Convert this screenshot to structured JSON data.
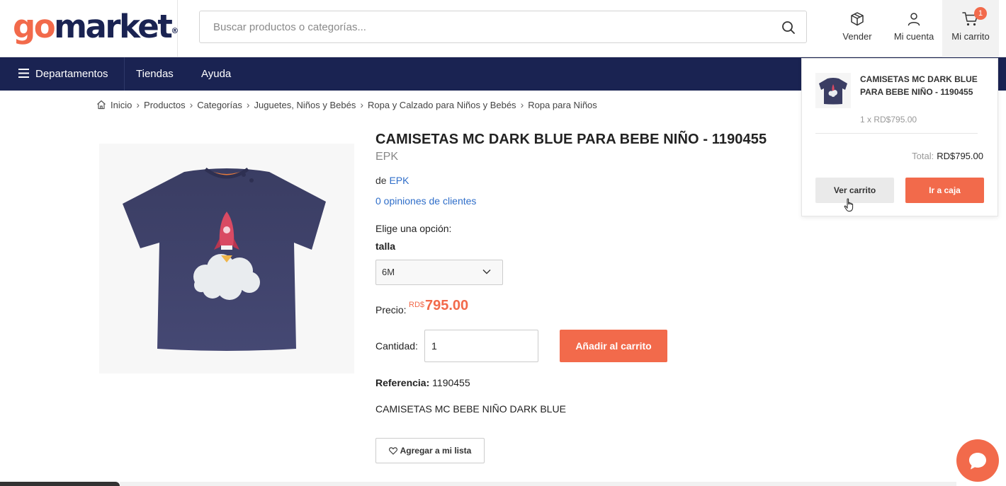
{
  "brand": {
    "logo_go": "go",
    "logo_market": "market",
    "logo_reg": "®"
  },
  "search": {
    "placeholder": "Buscar productos o categorías..."
  },
  "header_actions": {
    "sell": "Vender",
    "account": "Mi cuenta",
    "cart": "Mi carrito",
    "cart_count": "1"
  },
  "nav": {
    "departments": "Departamentos",
    "stores": "Tiendas",
    "help": "Ayuda"
  },
  "breadcrumb": [
    "Inicio",
    "Productos",
    "Categorías",
    "Juguetes, Niños y Bebés",
    "Ropa y Calzado para Niños y Bebés",
    "Ropa para Niños"
  ],
  "product": {
    "title": "CAMISETAS MC DARK BLUE PARA BEBE NIÑO - 1190455",
    "brand": "EPK",
    "seller_prefix": "de",
    "seller": "EPK",
    "reviews": "0 opiniones de clientes",
    "choose_option": "Elige una opción:",
    "attribute": "talla",
    "size_selected": "6M",
    "price_label": "Precio:",
    "price_currency": "RD$",
    "price": "795.00",
    "qty_label": "Cantidad:",
    "qty_value": "1",
    "add_to_cart": "Añadir al carrito",
    "ref_label": "Referencia:",
    "ref_value": "1190455",
    "description": "CAMISETAS MC BEBE NIÑO DARK BLUE",
    "wishlist": "Agregar a mi lista"
  },
  "cart_panel": {
    "item_name": "CAMISETAS MC DARK BLUE PARA BEBE NIÑO - 1190455",
    "item_qty": "1 x RD$795.00",
    "total_label": "Total:",
    "total_value": "RD$795.00",
    "view_cart": "Ver carrito",
    "checkout": "Ir a caja"
  },
  "colors": {
    "accent": "#f26a4b",
    "navy": "#1a2352",
    "link": "#2f6ec9"
  },
  "icons": [
    "search-icon",
    "box-icon",
    "user-icon",
    "cart-icon",
    "menu-icon",
    "home-icon",
    "chevron-right-icon",
    "chevron-down-icon",
    "heart-icon",
    "chat-icon",
    "pointer-cursor-icon"
  ]
}
